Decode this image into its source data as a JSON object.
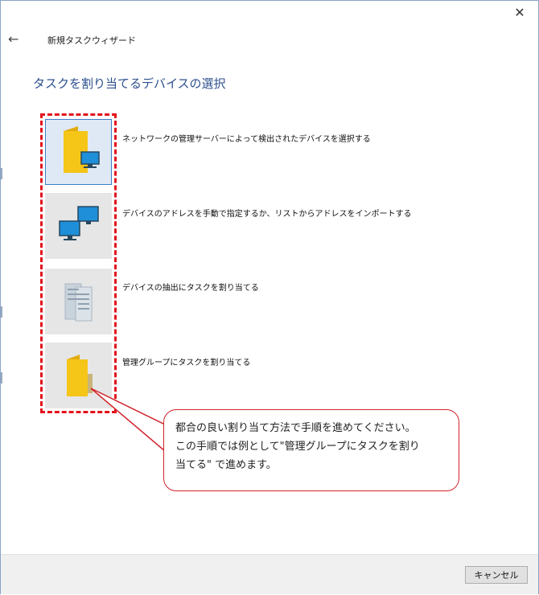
{
  "window": {
    "close_glyph": "✕",
    "back_glyph": "←",
    "title": "新規タスクウィザード"
  },
  "page": {
    "heading": "タスクを割り当てるデバイスの選択"
  },
  "options": [
    {
      "label": "ネットワークの管理サーバーによって検出されたデバイスを選択する",
      "icon": "folder-computer-icon",
      "selected": true
    },
    {
      "label": "デバイスのアドレスを手動で指定するか、リストからアドレスをインポートする",
      "icon": "computers-network-icon",
      "selected": false
    },
    {
      "label": "デバイスの抽出にタスクを割り当てる",
      "icon": "device-selection-icon",
      "selected": false
    },
    {
      "label": "管理グループにタスクを割り当てる",
      "icon": "folder-icon",
      "selected": false
    }
  ],
  "callout": {
    "lines": [
      "都合の良い割り当て方法で手順を進めてください。",
      "この手順では例として\"管理グループにタスクを割り",
      "当てる\" で進めます。"
    ]
  },
  "footer": {
    "cancel_label": "キャンセル"
  },
  "colors": {
    "heading": "#2d4f8e",
    "highlight": "#e2131c",
    "folder": "#f5c518",
    "monitor": "#1e8fd8"
  }
}
